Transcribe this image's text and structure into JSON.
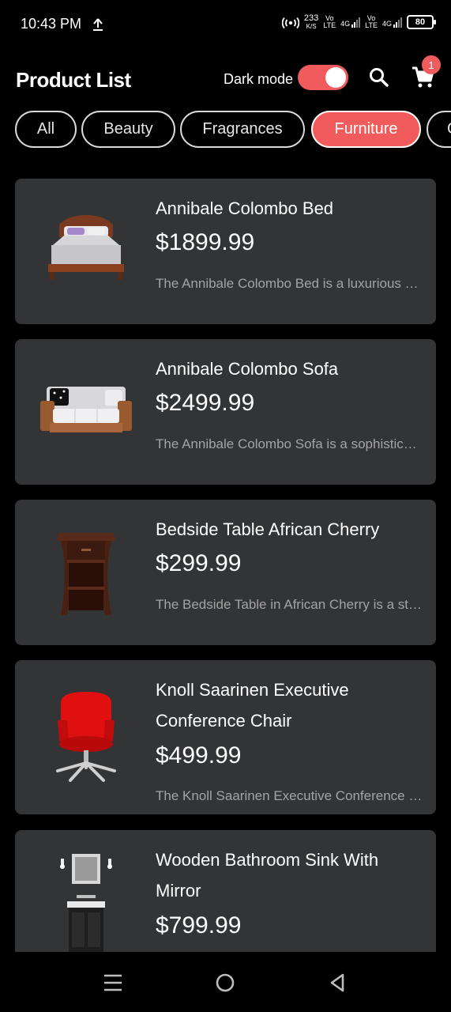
{
  "status": {
    "time": "10:43 PM",
    "speed_value": "233",
    "speed_unit": "K/S",
    "vo_label": "Vo",
    "lte_label": "LTE",
    "net_4g": "4G",
    "battery": "80",
    "icons": [
      "upload-icon",
      "hotspot-icon",
      "signal-icon",
      "battery-icon"
    ]
  },
  "header": {
    "title": "Product List",
    "dark_mode_label": "Dark mode",
    "dark_mode_on": true,
    "cart_count": "1",
    "accent_color": "#f25b5b"
  },
  "categories": {
    "items": [
      "All",
      "Beauty",
      "Fragrances",
      "Furniture",
      "G"
    ],
    "selected": "Furniture"
  },
  "products": [
    {
      "title": "Annibale Colombo Bed",
      "price": "$1899.99",
      "description": "The Annibale Colombo Bed is a luxurious and elegant bed frame",
      "image": "bed"
    },
    {
      "title": "Annibale Colombo Sofa",
      "price": "$2499.99",
      "description": "The Annibale Colombo Sofa is a sophisticated and comfortable",
      "image": "sofa"
    },
    {
      "title": "Bedside Table African Cherry",
      "price": "$299.99",
      "description": "The Bedside Table in African Cherry is a stylish and functional",
      "image": "bedside-table"
    },
    {
      "title": "Knoll Saarinen Executive Conference Chair",
      "price": "$499.99",
      "description": "The Knoll Saarinen Executive Conference Chair is a modern",
      "image": "chair"
    },
    {
      "title": "Wooden Bathroom Sink With Mirror",
      "price": "$799.99",
      "description": "",
      "image": "bathroom-sink"
    }
  ],
  "navigation": {
    "buttons": [
      "menu-icon",
      "home-icon",
      "back-icon"
    ]
  },
  "colors": {
    "background": "#000000",
    "card": "#333436",
    "accent": "#f25b5b",
    "description_text": "#a3a3a3"
  }
}
